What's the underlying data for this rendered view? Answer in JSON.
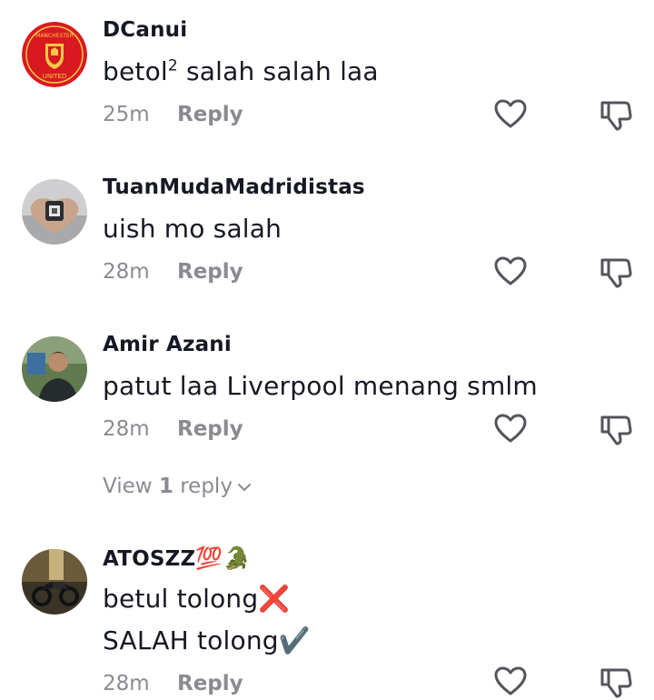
{
  "comments": [
    {
      "username": "DCanui",
      "text_main": "betol",
      "text_sup": "2",
      "text_rest": " salah salah laa",
      "time": "25m",
      "reply_label": "Reply",
      "avatar": "manchester-united-crest",
      "avatar_text_top": "MANCHESTER",
      "avatar_text_bottom": "UNITED"
    },
    {
      "username": "TuanMudaMadridistas",
      "text": "uish mo salah",
      "time": "28m",
      "reply_label": "Reply",
      "avatar": "hands-heart-photo"
    },
    {
      "username": "Amir Azani",
      "text": "patut laa Liverpool menang smlm",
      "time": "28m",
      "reply_label": "Reply",
      "avatar": "person-photo",
      "view_replies": {
        "prefix": "View ",
        "count": "1",
        "suffix": " reply"
      }
    },
    {
      "username": "ATOSZZ",
      "username_emojis": "💯🐊",
      "line1": "betul tolong",
      "line1_emoji": "❌",
      "line2": "SALAH tolong",
      "line2_emoji": "✔️",
      "time": "28m",
      "reply_label": "Reply",
      "avatar": "motorcycle-photo"
    }
  ],
  "colors": {
    "text": "#161823",
    "muted": "#8a8b91",
    "icon_stroke": "#54555b"
  }
}
